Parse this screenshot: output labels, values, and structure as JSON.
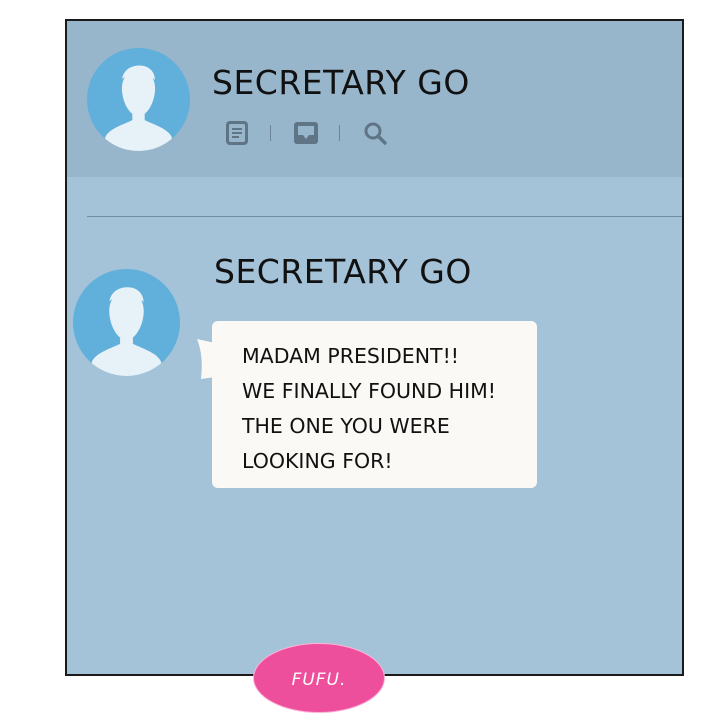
{
  "header": {
    "contact_name": "SECRETARY GO",
    "icons": [
      "notes-icon",
      "inbox-icon",
      "search-icon"
    ]
  },
  "message": {
    "sender_name": "SECRETARY GO",
    "lines": [
      "MADAM PRESIDENT!!",
      "WE FINALLY FOUND HIM!",
      "THE ONE YOU WERE",
      "LOOKING FOR!"
    ]
  },
  "watermark": {
    "text": "FUFU."
  },
  "colors": {
    "chat_background": "#a5c3d8",
    "header_background": "#97b6cc",
    "avatar_background": "#61afdb",
    "avatar_silhouette": "#e6f1f8",
    "bubble": "#fbf9f5",
    "watermark": "#ee4f9c"
  }
}
